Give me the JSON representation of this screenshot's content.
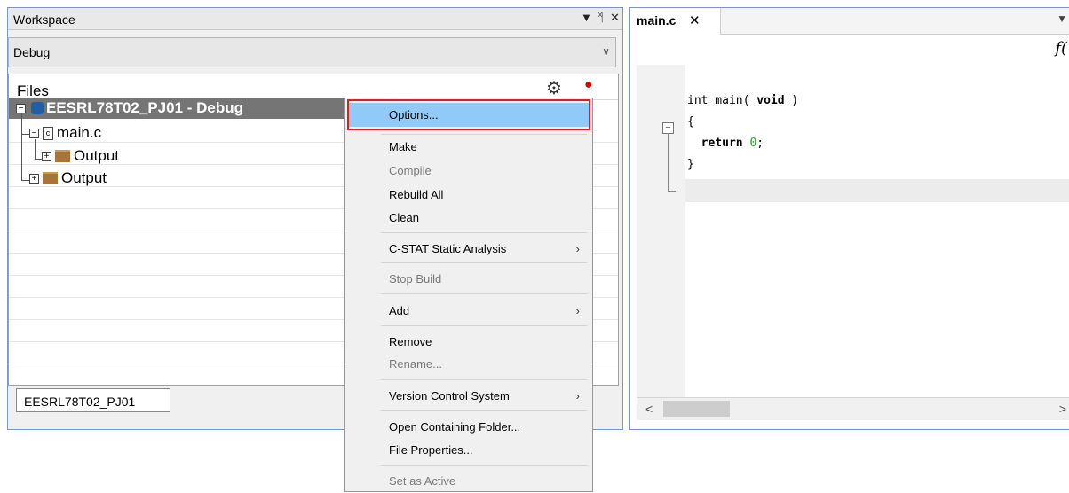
{
  "workspace": {
    "title": "Workspace",
    "controls": {
      "dropdown": "▼",
      "pin": "ᛗ",
      "close": "✕"
    },
    "config_value": "Debug",
    "files_label": "Files",
    "tree": {
      "project": "EESRL78T02_PJ01 - Debug",
      "file": "main.c",
      "file_output": "Output",
      "output": "Output"
    },
    "project_tab": "EESRL78T02_PJ01"
  },
  "editor": {
    "tab_name": "main.c",
    "tab_close": "✕",
    "func_icon": "f(",
    "code": {
      "line1_a": "int main( ",
      "line1_kw": "void",
      "line1_b": " )",
      "line2": "{",
      "line3_kw": "return",
      "line3_num": "0",
      "line3_end": ";",
      "line4": "}"
    }
  },
  "context_menu": {
    "items": [
      {
        "label": "Options...",
        "selected": true
      },
      {
        "label": "Make"
      },
      {
        "label": "Compile",
        "disabled": true
      },
      {
        "label": "Rebuild All"
      },
      {
        "label": "Clean"
      },
      {
        "label": "C-STAT Static Analysis",
        "submenu": true
      },
      {
        "label": "Stop Build",
        "disabled": true
      },
      {
        "label": "Add",
        "submenu": true
      },
      {
        "label": "Remove"
      },
      {
        "label": "Rename...",
        "disabled": true
      },
      {
        "label": "Version Control System",
        "submenu": true
      },
      {
        "label": "Open Containing Folder..."
      },
      {
        "label": "File Properties..."
      },
      {
        "label": "Set as Active",
        "disabled": true
      }
    ],
    "submenu_arrow": "›"
  },
  "colors": {
    "selection": "#91c9f7",
    "highlight_box": "#e01b24",
    "project_row": "#757575"
  }
}
